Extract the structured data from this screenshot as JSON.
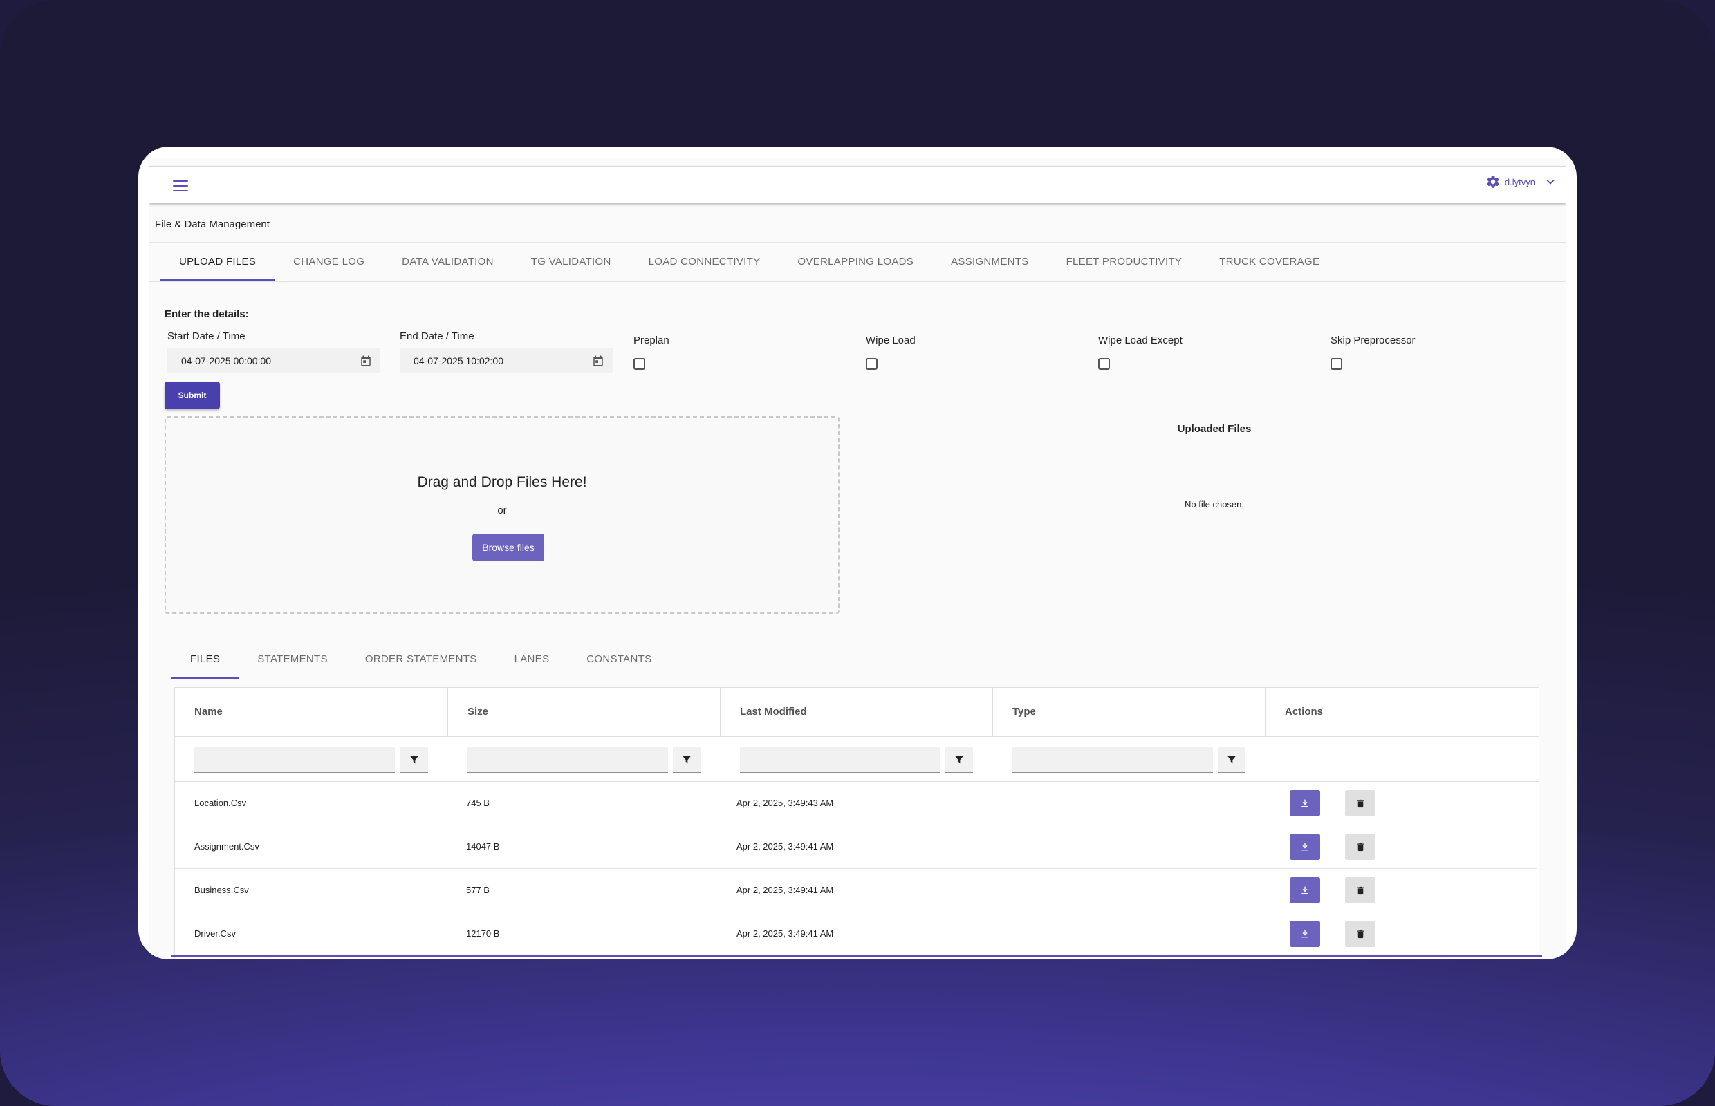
{
  "header": {
    "user": "d.lytvyn"
  },
  "page": {
    "title": "File & Data Management"
  },
  "main_tabs": [
    {
      "label": "UPLOAD FILES",
      "active": true
    },
    {
      "label": "CHANGE LOG"
    },
    {
      "label": "DATA VALIDATION"
    },
    {
      "label": "TG VALIDATION"
    },
    {
      "label": "LOAD CONNECTIVITY"
    },
    {
      "label": "OVERLAPPING LOADS"
    },
    {
      "label": "ASSIGNMENTS"
    },
    {
      "label": "FLEET PRODUCTIVITY"
    },
    {
      "label": "TRUCK COVERAGE"
    }
  ],
  "form": {
    "heading": "Enter the details:",
    "start_label": "Start Date / Time",
    "start_value": "04-07-2025 00:00:00",
    "end_label": "End Date / Time",
    "end_value": "04-07-2025 10:02:00",
    "checkboxes": [
      {
        "label": "Preplan",
        "checked": false
      },
      {
        "label": "Wipe Load",
        "checked": false
      },
      {
        "label": "Wipe Load Except",
        "checked": false
      },
      {
        "label": "Skip Preprocessor",
        "checked": false
      }
    ],
    "submit_label": "Submit"
  },
  "dropzone": {
    "title": "Drag and Drop Files Here!",
    "or": "or",
    "browse_label": "Browse files"
  },
  "uploaded": {
    "title": "Uploaded Files",
    "empty": "No file chosen."
  },
  "sub_tabs": [
    {
      "label": "FILES",
      "active": true
    },
    {
      "label": "STATEMENTS"
    },
    {
      "label": "ORDER STATEMENTS"
    },
    {
      "label": "LANES"
    },
    {
      "label": "CONSTANTS"
    }
  ],
  "table": {
    "columns": [
      "Name",
      "Size",
      "Last Modified",
      "Type",
      "Actions"
    ],
    "rows": [
      {
        "name": "Location.Csv",
        "size": "745 B",
        "modified": "Apr 2, 2025, 3:49:43 AM",
        "type": ""
      },
      {
        "name": "Assignment.Csv",
        "size": "14047 B",
        "modified": "Apr 2, 2025, 3:49:41 AM",
        "type": ""
      },
      {
        "name": "Business.Csv",
        "size": "577 B",
        "modified": "Apr 2, 2025, 3:49:41 AM",
        "type": ""
      },
      {
        "name": "Driver.Csv",
        "size": "12170 B",
        "modified": "Apr 2, 2025, 3:49:41 AM",
        "type": ""
      }
    ]
  },
  "colors": {
    "accent": "#4a3fae",
    "accent_light": "#6b63bd",
    "background_gradient": "#3d358f"
  },
  "icons": {
    "menu": "hamburger-icon",
    "user_settings": "gear-icon",
    "user_menu": "chevron-down-icon",
    "date": "calendar-icon",
    "filter": "filter-icon",
    "download": "download-icon",
    "delete": "trash-icon"
  }
}
